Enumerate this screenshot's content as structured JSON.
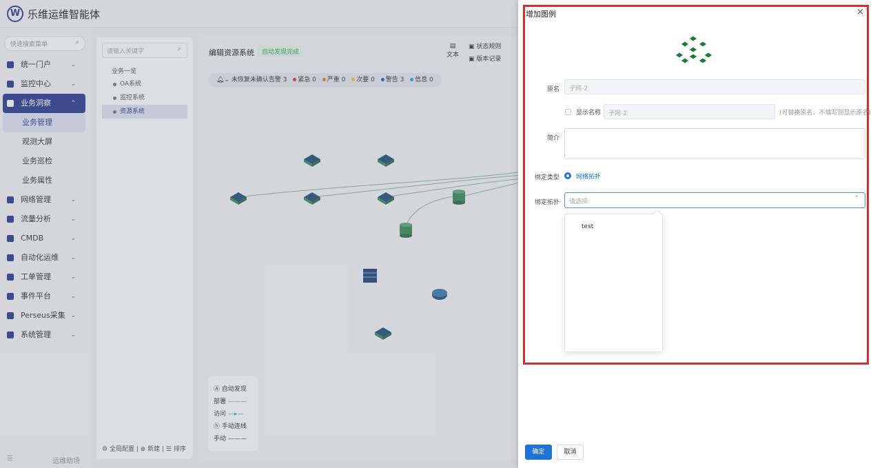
{
  "app": {
    "title": "乐维运维智能体",
    "logo_letter": "W"
  },
  "sidebar": {
    "search_placeholder": "快速搜索菜单",
    "items": [
      {
        "label": "统一门户",
        "icon": "home-icon"
      },
      {
        "label": "监控中心",
        "icon": "monitor-icon"
      },
      {
        "label": "业务洞察",
        "icon": "insight-icon",
        "active": true,
        "children": [
          "业务管理",
          "观测大屏",
          "业务巡检",
          "业务属性"
        ]
      },
      {
        "label": "网络管理",
        "icon": "globe-icon"
      },
      {
        "label": "流量分析",
        "icon": "chart-icon"
      },
      {
        "label": "CMDB",
        "icon": "cube-icon"
      },
      {
        "label": "自动化运维",
        "icon": "gear-icon"
      },
      {
        "label": "工单管理",
        "icon": "ticket-icon"
      },
      {
        "label": "事件平台",
        "icon": "bell-icon"
      },
      {
        "label": "Perseus采集",
        "icon": "diamond-icon"
      },
      {
        "label": "系统管理",
        "icon": "settings-icon"
      }
    ],
    "bottom_label": "运维助场"
  },
  "tree": {
    "search_placeholder": "请输入关键字",
    "root": "业务一览",
    "nodes": [
      "OA系统",
      "监控系统",
      "资源系统"
    ],
    "footer": {
      "global_config": "全局配置",
      "new": "新建",
      "sort": "排序"
    }
  },
  "editor": {
    "title": "编辑资源系统",
    "tag": "自动发现完成",
    "tools": {
      "text": "文本",
      "status_rule": "状态规则",
      "version": "版本记录"
    },
    "alarm": {
      "label": "未恢复未确认告警 3",
      "items": [
        {
          "label": "紧急 0",
          "color": "#e53935"
        },
        {
          "label": "严重 0",
          "color": "#f57c00"
        },
        {
          "label": "次要 0",
          "color": "#fbc02d"
        },
        {
          "label": "警告 3",
          "color": "#1e63c8"
        },
        {
          "label": "信息 0",
          "color": "#26a6d1"
        }
      ]
    },
    "legend": {
      "auto": "自动发现",
      "deploy": "部署",
      "access": "访问",
      "manual_link": "手动连线",
      "manual": "手动"
    }
  },
  "drawer": {
    "title": "增加图例",
    "fields": {
      "orig_name_label": "原名",
      "orig_name_value": "子网-2",
      "show_name_label": "显示名称",
      "show_name_value": "子网-2",
      "show_name_hint": "(可替换原名，不填写则显示原名)",
      "intro_label": "简介",
      "bind_type_label": "绑定类型",
      "bind_type_option": "网络拓扑",
      "bind_topo_label": "绑定拓扑",
      "bind_topo_placeholder": "请选择"
    },
    "dropdown_options": [
      "test"
    ],
    "buttons": {
      "ok": "确定",
      "cancel": "取消"
    }
  }
}
